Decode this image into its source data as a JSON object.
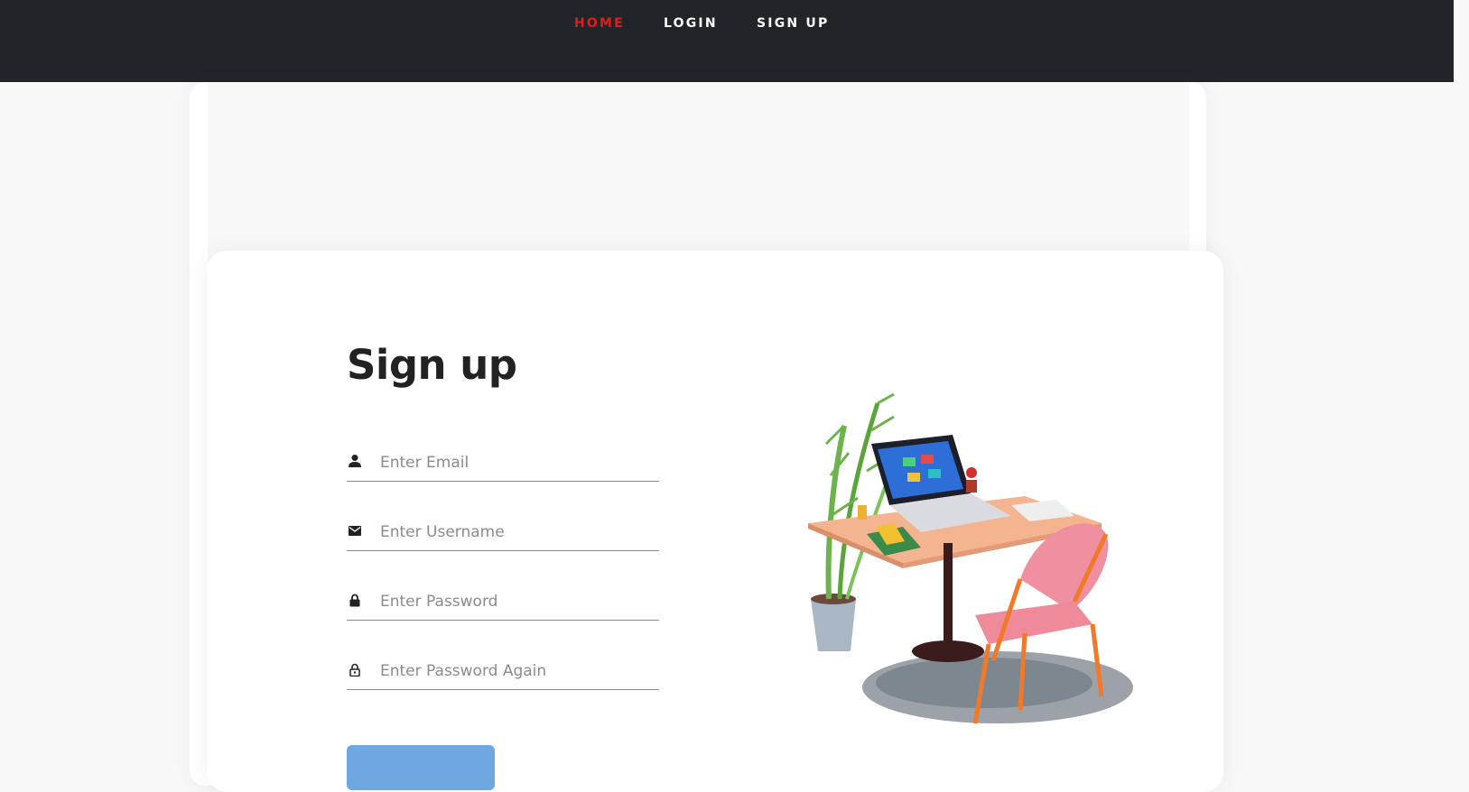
{
  "nav": {
    "items": [
      {
        "label": "HOME",
        "active": true
      },
      {
        "label": "LOGIN",
        "active": false
      },
      {
        "label": "SIGN UP",
        "active": false
      }
    ]
  },
  "form": {
    "title": "Sign up",
    "fields": [
      {
        "icon": "user-icon",
        "placeholder": "Enter Email",
        "value": ""
      },
      {
        "icon": "envelope-icon",
        "placeholder": "Enter Username",
        "value": ""
      },
      {
        "icon": "lock-icon",
        "placeholder": "Enter Password",
        "value": ""
      },
      {
        "icon": "lock-open-icon",
        "placeholder": "Enter Password Again",
        "value": ""
      }
    ],
    "submit_label": ""
  },
  "illustration": {
    "icon": "desk-workspace-illustration"
  },
  "colors": {
    "navbar": "#212529",
    "nav_active": "#e31b1b",
    "nav_text": "#ffffff",
    "button": "#6fa8e0",
    "title": "#222222"
  }
}
